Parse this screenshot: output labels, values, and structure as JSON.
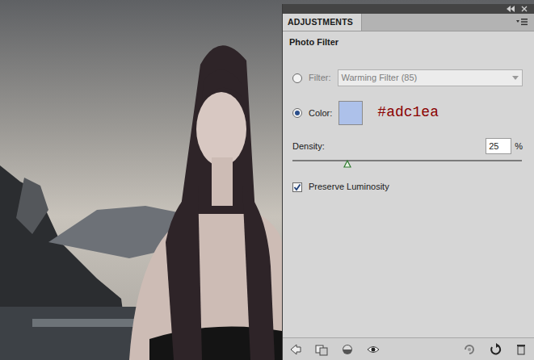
{
  "panel": {
    "tab": "ADJUSTMENTS",
    "title": "Photo Filter"
  },
  "options": [
    {
      "kind": "preset",
      "label": "Filter:",
      "selected": false,
      "value": "Warming Filter (85)",
      "disabled": true
    },
    {
      "kind": "color",
      "label": "Color:",
      "selected": true,
      "color": "#adc1ea",
      "annotation": "#adc1ea"
    }
  ],
  "density": {
    "label": "Density:",
    "value": "25",
    "unit": "%",
    "level": 0.24
  },
  "preserve_luminosity": {
    "label": "Preserve Luminosity",
    "checked": true
  }
}
